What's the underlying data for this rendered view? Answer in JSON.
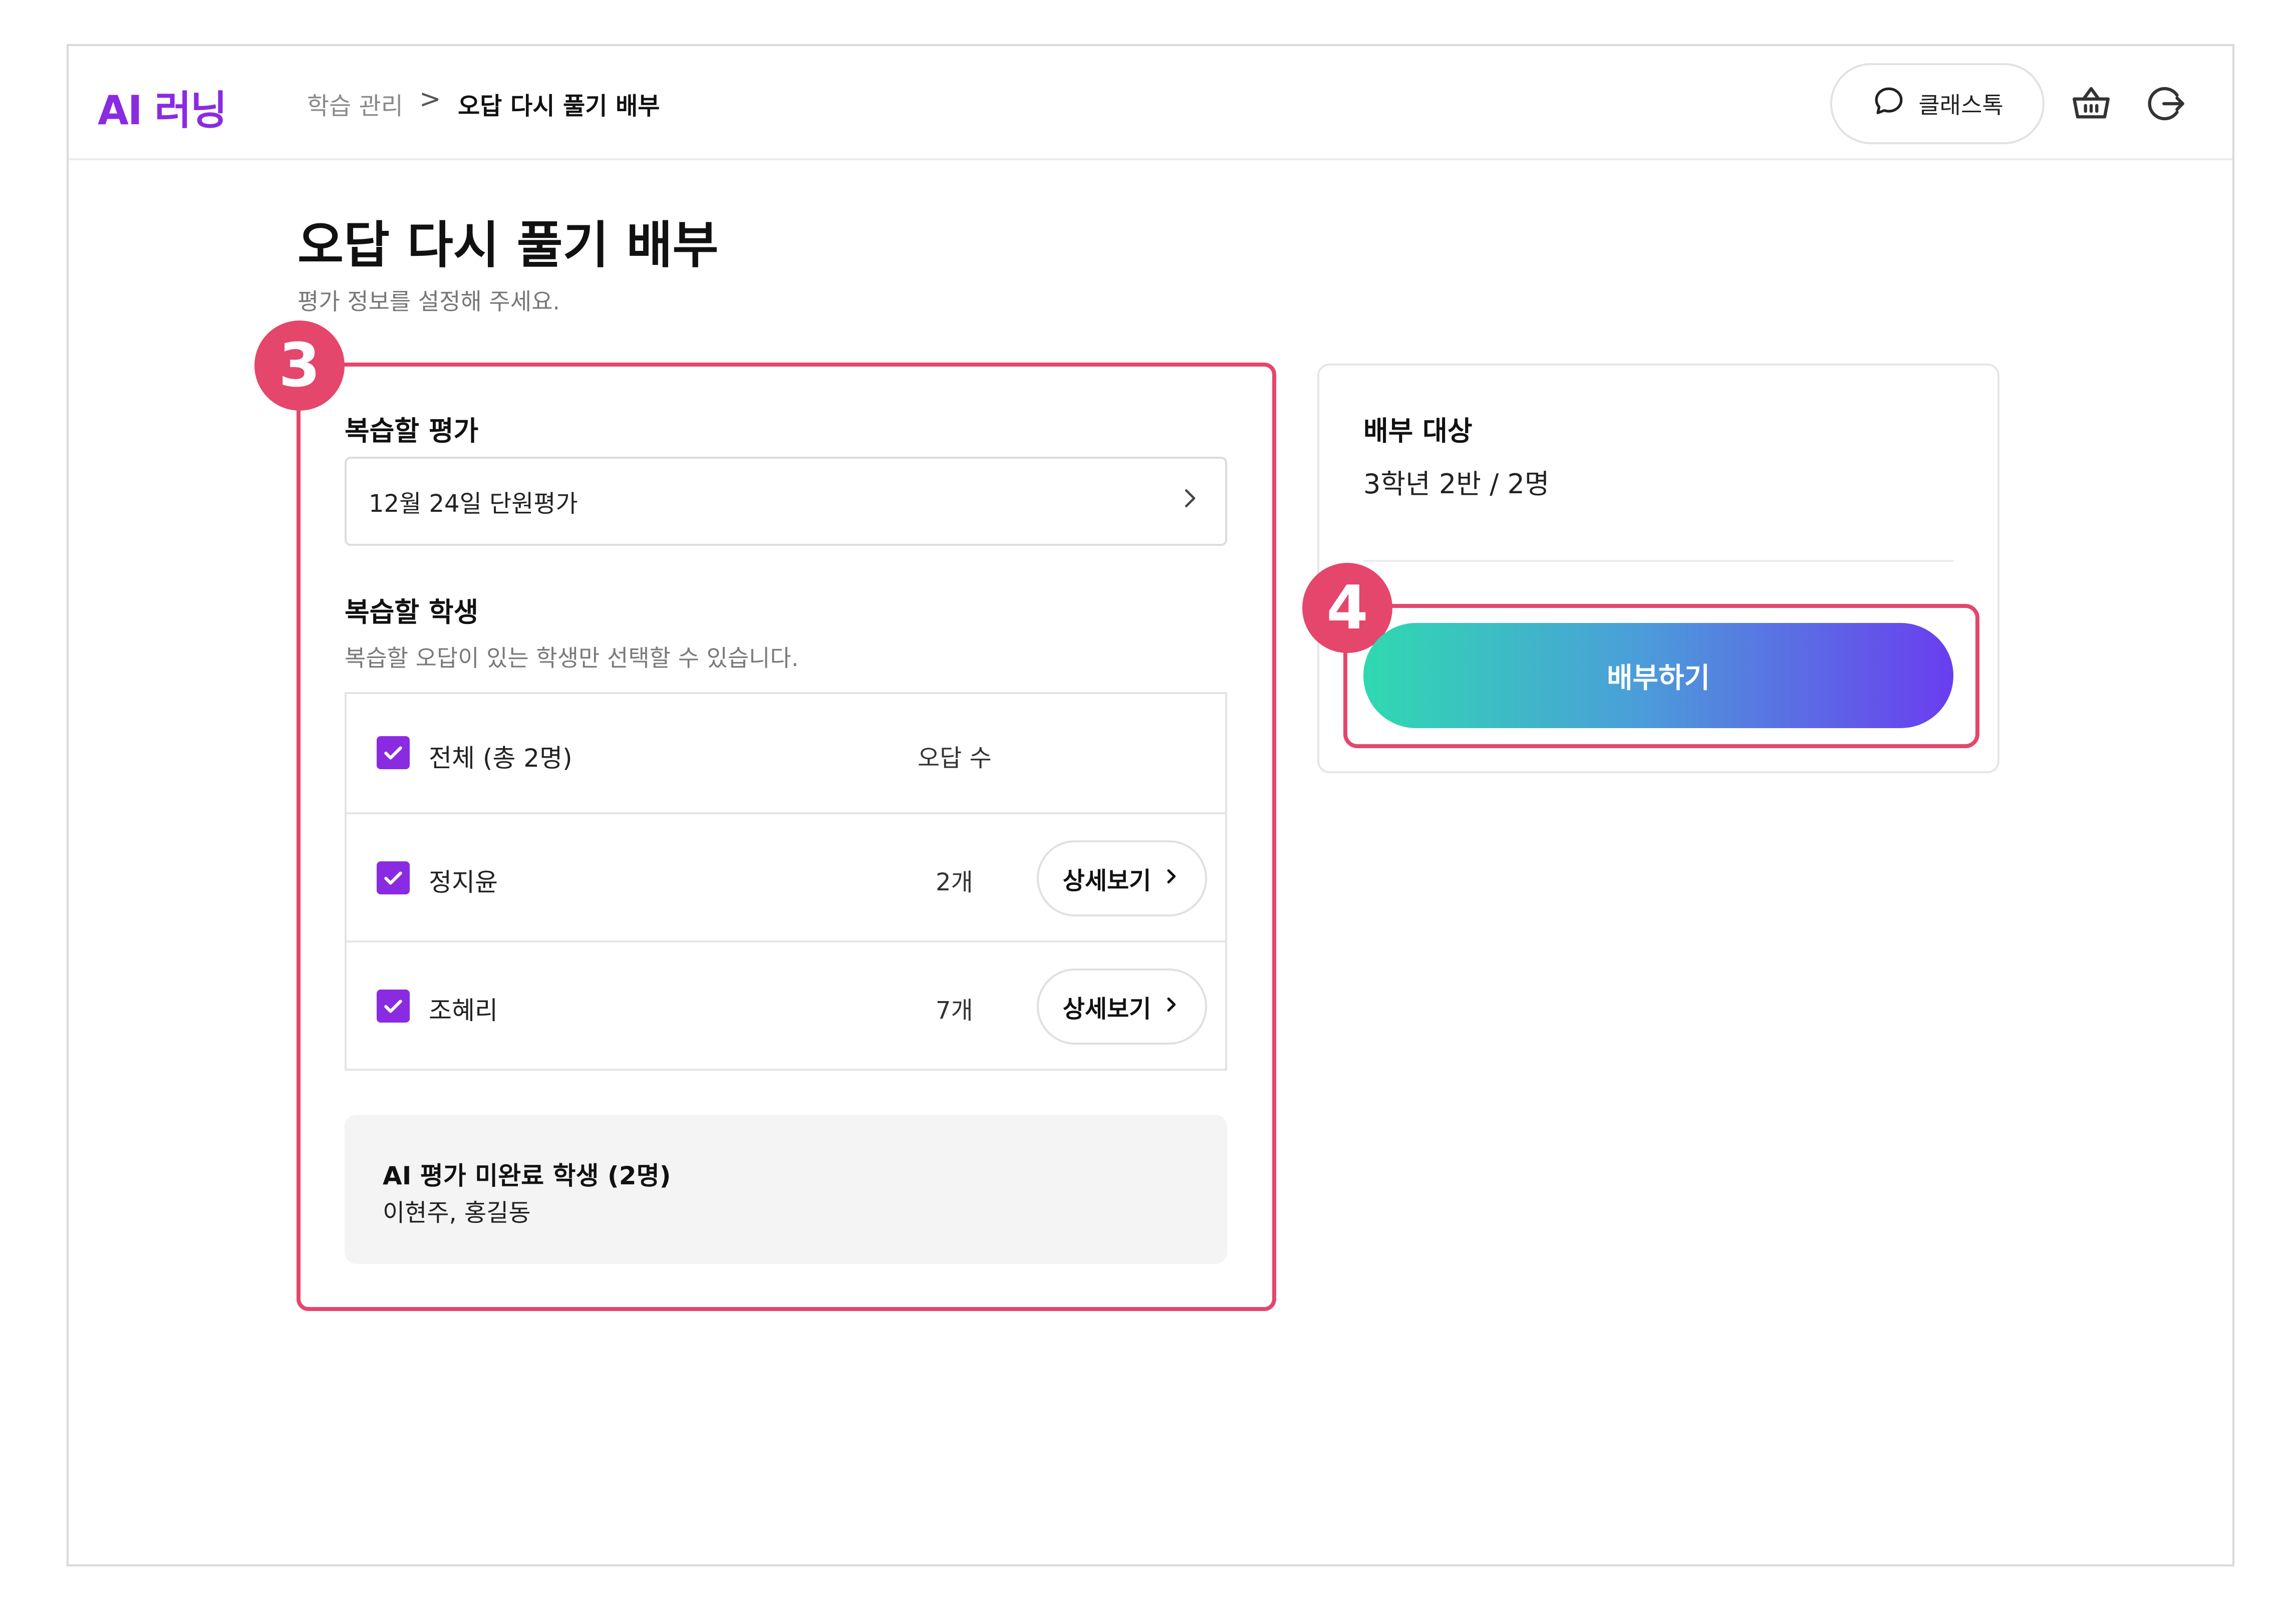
{
  "header": {
    "logo": "AI 러닝",
    "breadcrumb": {
      "parent": "학습 관리",
      "separator": ">",
      "current": "오답 다시 풀기 배부"
    },
    "classtalk_label": "클래스톡",
    "icons": [
      "chat-bubble-icon",
      "basket-icon",
      "logout-icon"
    ]
  },
  "page": {
    "title": "오답 다시 풀기 배부",
    "subtitle": "평가 정보를 설정해 주세요."
  },
  "left_panel": {
    "badge": "3",
    "assessment": {
      "title": "복습할 평가",
      "selected": "12월 24일 단원평가"
    },
    "students": {
      "title": "복습할 학생",
      "description": "복습할 오답이 있는 학생만 선택할 수 있습니다.",
      "header": {
        "all_label": "전체 (총 2명)",
        "count_label": "오답 수",
        "checked": true
      },
      "rows": [
        {
          "name": "정지윤",
          "count": "2개",
          "checked": true,
          "detail_label": "상세보기"
        },
        {
          "name": "조혜리",
          "count": "7개",
          "checked": true,
          "detail_label": "상세보기"
        }
      ]
    },
    "incomplete": {
      "title": "AI 평가 미완료 학생 (2명)",
      "names": "이현주, 홍길동"
    }
  },
  "right_panel": {
    "badge": "4",
    "target_label": "배부 대상",
    "target_value": "3학년 2반 / 2명",
    "distribute_label": "배부하기"
  },
  "colors": {
    "brand": "#8a2be2",
    "highlight": "#e5466b",
    "gradient_start": "#2fd9b0",
    "gradient_end": "#6a3df0"
  }
}
